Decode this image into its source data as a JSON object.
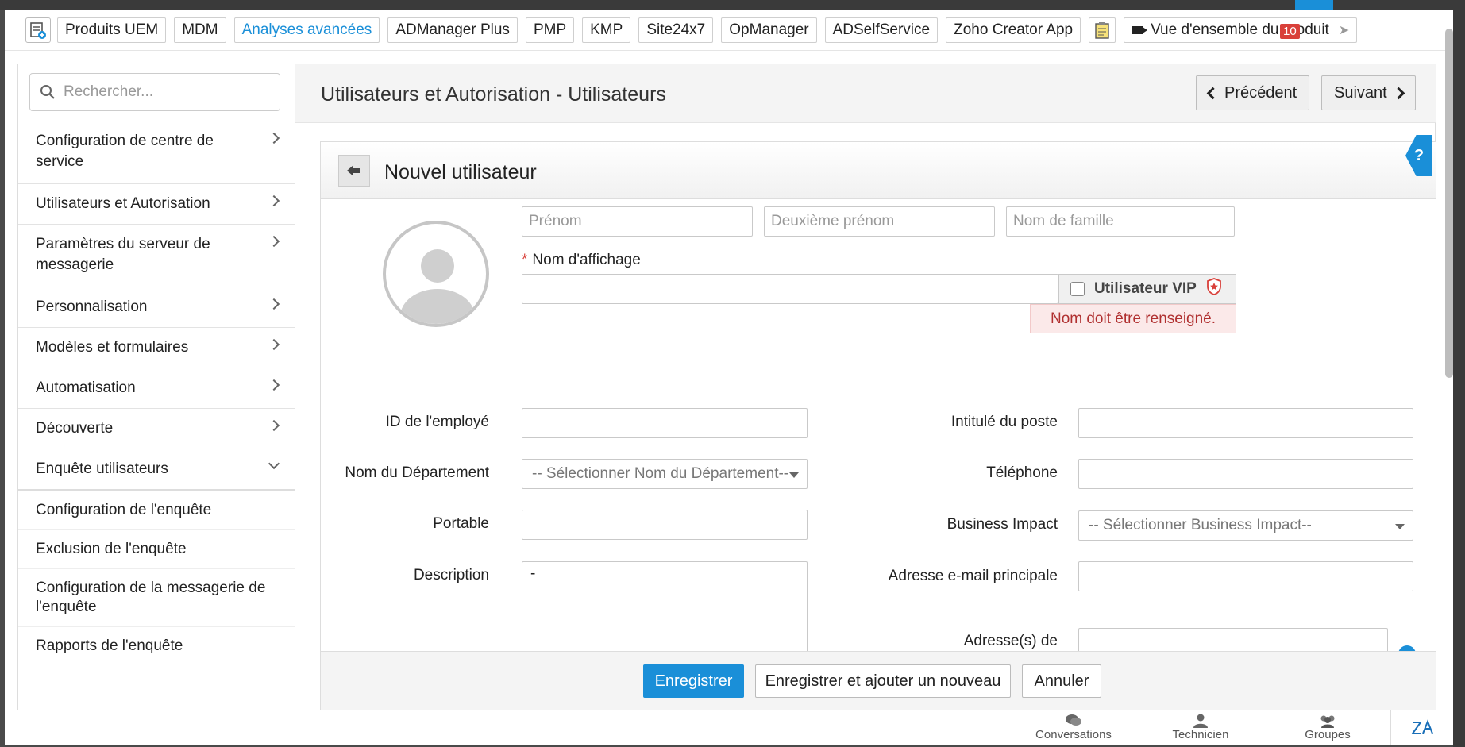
{
  "product_bar": {
    "chips": [
      "Produits UEM",
      "MDM",
      "Analyses avancées",
      "ADManager Plus",
      "PMP",
      "KMP",
      "Site24x7",
      "OpManager",
      "ADSelfService",
      "Zoho Creator App"
    ],
    "overview_label": "Vue d'ensemble du produit",
    "badge_count": "10"
  },
  "sidebar": {
    "search_placeholder": "Rechercher...",
    "items": [
      {
        "label": "Configuration de centre de service"
      },
      {
        "label": "Utilisateurs et Autorisation"
      },
      {
        "label": "Paramètres du serveur de messagerie"
      },
      {
        "label": "Personnalisation"
      },
      {
        "label": "Modèles et formulaires"
      },
      {
        "label": "Automatisation"
      },
      {
        "label": "Découverte"
      },
      {
        "label": "Enquête utilisateurs"
      }
    ],
    "subitems": [
      {
        "label": "Configuration de l'enquête"
      },
      {
        "label": "Exclusion de l'enquête"
      },
      {
        "label": "Configuration de la messagerie de l'enquête"
      },
      {
        "label": "Rapports de l'enquête"
      }
    ]
  },
  "header": {
    "title": "Utilisateurs et Autorisation - Utilisateurs",
    "prev_label": "Précédent",
    "next_label": "Suivant"
  },
  "form": {
    "title": "Nouvel utilisateur",
    "first_name_placeholder": "Prénom",
    "middle_name_placeholder": "Deuxième prénom",
    "last_name_placeholder": "Nom de famille",
    "display_name_label": "Nom d'affichage",
    "required_mark": "*",
    "vip_label": "Utilisateur VIP",
    "error_text": "Nom doit être renseigné.",
    "employee_id_label": "ID de l'employé",
    "job_title_label": "Intitulé du poste",
    "department_label": "Nom du Département",
    "department_select": "-- Sélectionner Nom du Département--",
    "phone_label": "Téléphone",
    "mobile_label": "Portable",
    "business_impact_label": "Business Impact",
    "business_impact_select": "-- Sélectionner Business Impact--",
    "description_label": "Description",
    "description_value": "-",
    "primary_email_label": "Adresse e-mail principale",
    "secondary_email_label": "Adresse(s) de"
  },
  "footer": {
    "save_label": "Enregistrer",
    "save_new_label": "Enregistrer et ajouter un nouveau",
    "cancel_label": "Annuler"
  },
  "bottom_bar": {
    "conversations_label": "Conversations",
    "technician_label": "Technicien",
    "groups_label": "Groupes"
  },
  "colors": {
    "accent": "#1a8fd8",
    "error": "#d9403a"
  }
}
